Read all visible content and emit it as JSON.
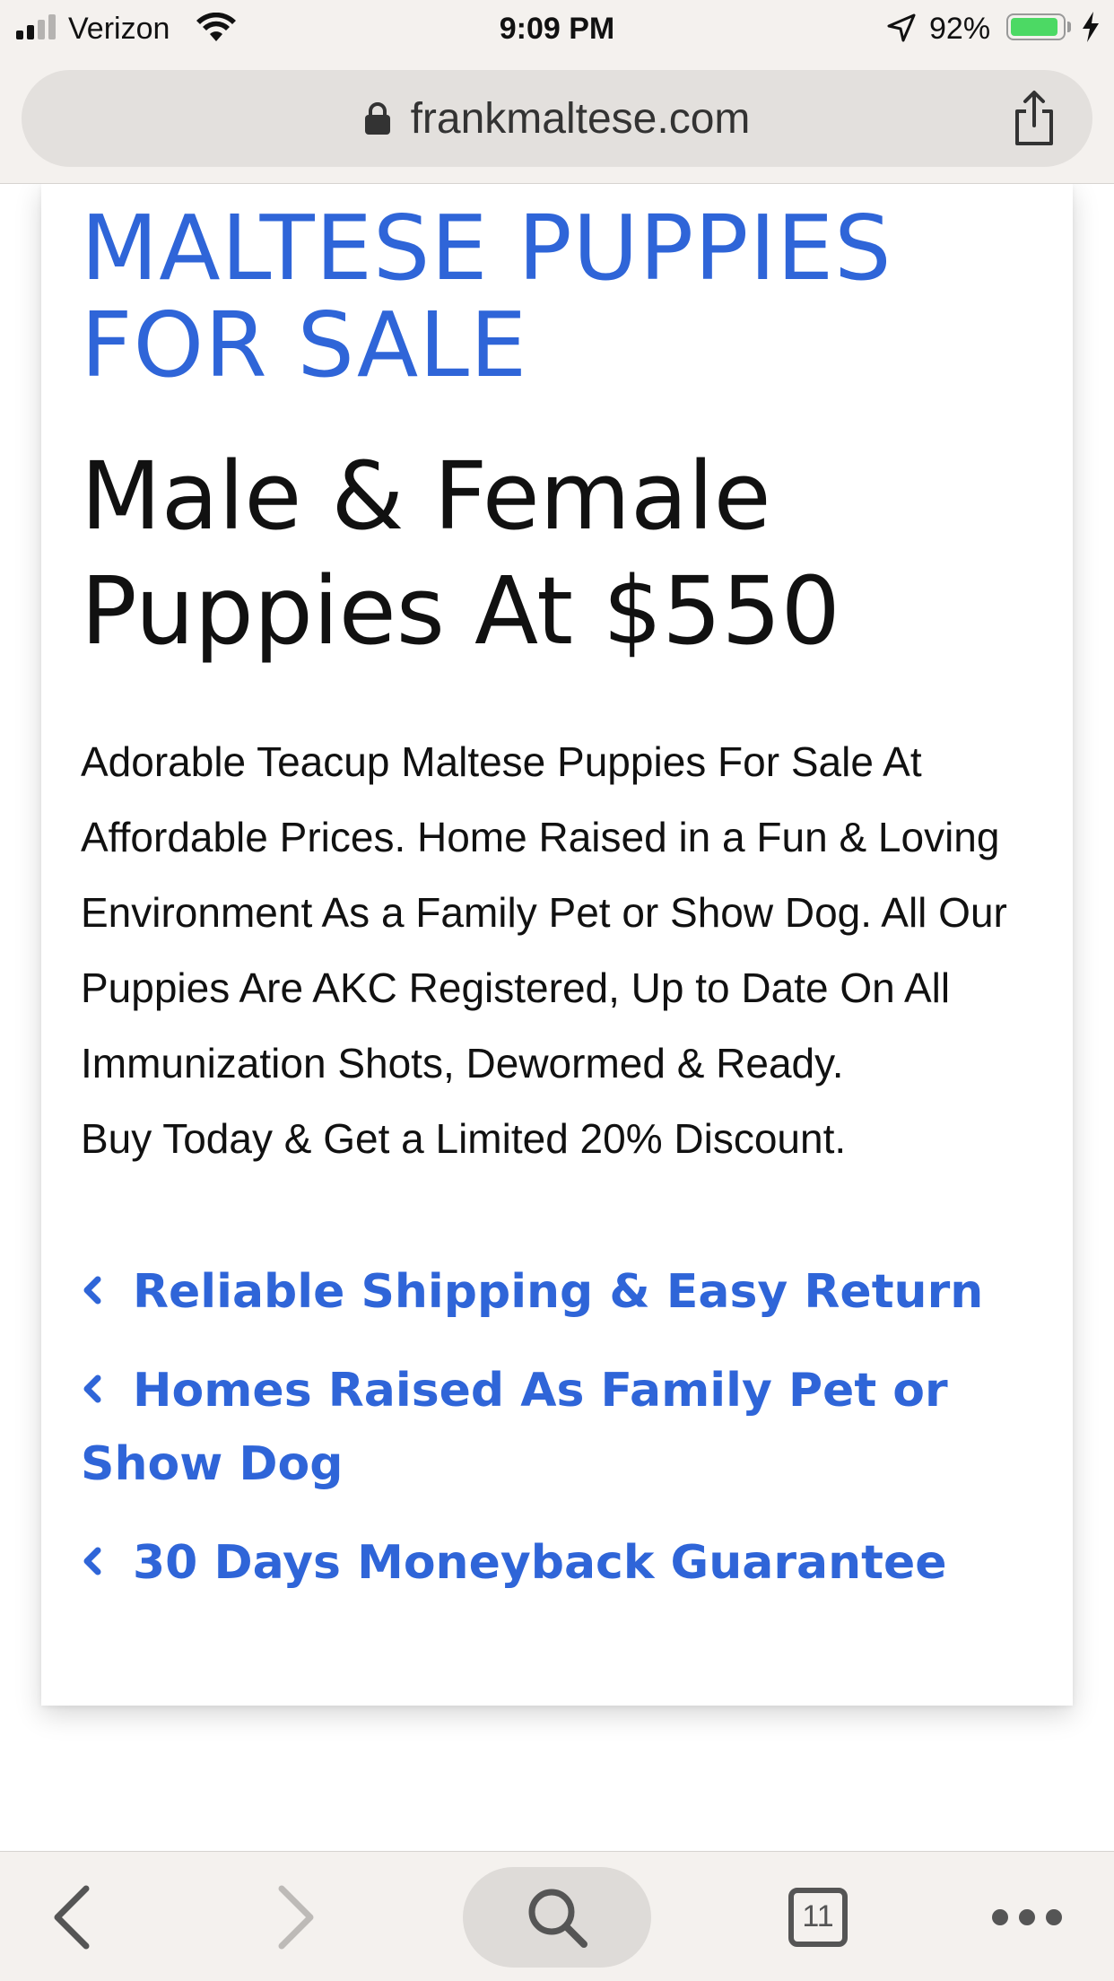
{
  "status_bar": {
    "carrier": "Verizon",
    "time": "9:09 PM",
    "battery_percent": "92%",
    "battery_level": 0.92
  },
  "browser": {
    "url": "frankmaltese.com",
    "tab_count": "11"
  },
  "page": {
    "headline": "MALTESE PUPPIES FOR SALE",
    "subheadline": "Male & Female Puppies At $550",
    "description": "Adorable Teacup Maltese Puppies For Sale At Affordable Prices. Home Raised in a Fun & Loving Environment As a Family Pet or Show Dog. All Our Puppies Are AKC Registered, Up to Date On All Immunization Shots, Dewormed & Ready.",
    "promo": "Buy Today & Get a Limited 20% Discount.",
    "features": [
      "Reliable Shipping & Easy Return",
      "Homes Raised As Family Pet or Show Dog",
      "30 Days Moneyback Guarantee"
    ]
  },
  "icons": {
    "lock": "lock-icon",
    "share": "share-icon",
    "back": "chevron-left-icon",
    "forward": "chevron-right-icon",
    "search": "search-icon",
    "tabs": "tabs-icon",
    "more": "more-icon",
    "bullet": "chevron-left-icon"
  },
  "colors": {
    "accent": "#2f65d8",
    "chrome_background": "#f4f1ee",
    "battery": "#4cd964"
  }
}
